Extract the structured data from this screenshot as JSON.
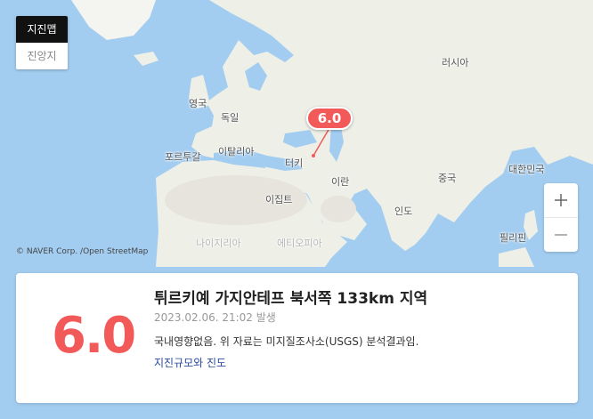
{
  "tabs": [
    {
      "label": "지진맵",
      "active": true
    },
    {
      "label": "진앙지",
      "active": false
    }
  ],
  "map": {
    "labels": {
      "russia": "러시아",
      "uk": "영국",
      "germany": "독일",
      "italy": "이탈리아",
      "portugal": "포르투갈",
      "turkey": "터키",
      "egypt": "이집트",
      "iran": "이란",
      "china": "중국",
      "korea": "대한민국",
      "india": "인도",
      "philippines": "필리핀",
      "nigeria": "나이지리아",
      "ethiopia": "에티오피아"
    },
    "attribution": "© NAVER Corp. /Open StreetMap",
    "marker_magnitude": "6.0"
  },
  "zoom": {
    "in_label": "+",
    "out_label": "−"
  },
  "quake": {
    "magnitude": "6.0",
    "location": "튀르키예 가지안테프 북서쪽 133km 지역",
    "time": "2023.02.06. 21:02 발생",
    "note": "국내영향없음. 위 자료는 미지질조사소(USGS) 분석결과임.",
    "link": "지진규모와 진도"
  },
  "colors": {
    "accent": "#f25a5a",
    "sea": "#a3cdf0",
    "land": "#eef0e8",
    "link": "#2a4b9e"
  }
}
